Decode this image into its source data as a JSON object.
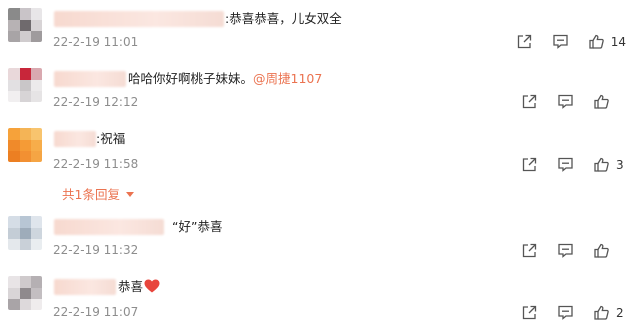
{
  "comments": [
    {
      "text": ":恭喜恭喜，儿女双全",
      "mention": "",
      "time": "22-2-19 11:01",
      "likes": "14",
      "has_heart": false
    },
    {
      "text": "哈哈你好啊桃子妹妹。",
      "mention": "@周捷1107",
      "time": "22-2-19 12:12",
      "likes": "",
      "has_heart": false
    },
    {
      "text": ":祝福",
      "mention": "",
      "time": "22-2-19 11:58",
      "likes": "3",
      "has_heart": false,
      "replies_label": "共1条回复"
    },
    {
      "text": "“好”恭喜",
      "mention": "",
      "time": "22-2-19 11:32",
      "likes": "",
      "has_heart": false
    },
    {
      "text": "恭喜",
      "mention": "",
      "time": "22-2-19 11:07",
      "likes": "2",
      "has_heart": true
    }
  ],
  "icons": {
    "share": "share-icon",
    "comment": "comment-icon",
    "like": "thumbs-up-icon",
    "heart": "heart-emoji-icon",
    "caret": "caret-down-icon"
  },
  "colors": {
    "accent": "#eb7350",
    "time": "#8d8d8d",
    "heart": "#e8453c"
  }
}
